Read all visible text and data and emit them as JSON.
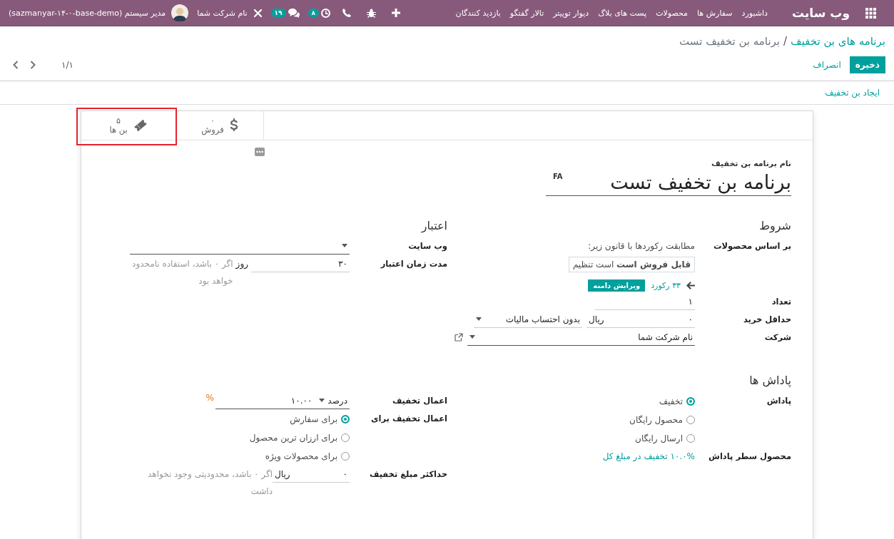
{
  "navbar": {
    "app_name": "وب سایت",
    "menu": [
      "داشبورد",
      "سفارش ها",
      "محصولات",
      "پست های بلاگ",
      "دیوار توییتر",
      "تالار گفتگو",
      "بازدید کنندگان"
    ],
    "activity_badge": "۸",
    "messages_badge": "۱۹",
    "company": "نام شرکت شما",
    "user": "مدیر سیستم (sazmanyar-۱۴-۰-base-demo)"
  },
  "breadcrumb": {
    "parent": "برنامه های بن تخفیف",
    "separator": "/",
    "current": "برنامه بن تخفیف تست"
  },
  "buttons": [
    {
      "label": "ذخیره",
      "kind": "primary"
    },
    {
      "label": "انصراف",
      "kind": "link"
    }
  ],
  "pager": "۱/۱",
  "toolbar_links": [
    "ایجاد بن تخفیف"
  ],
  "stat_buttons": [
    {
      "kind": "sales",
      "count": "۰",
      "label": "فروش",
      "highlighted": false
    },
    {
      "kind": "coupons",
      "count": "۵",
      "label": "بن ها",
      "highlighted": true
    }
  ],
  "form": {
    "name_label": "نام برنامه بن تخفیف",
    "name": "برنامه بن تخفیف تست",
    "language": "FA",
    "conditions": {
      "title": "شروط",
      "rows": [
        {
          "kind": "domain",
          "label": "بر اساس محصولات",
          "intro": "مطابقت رکوردها با قانون زیر:",
          "rule": "**قابل فروش است** است تنظیم",
          "records": "۳۳ رکورد",
          "button": "ویرایش دامنه"
        },
        {
          "kind": "input",
          "label": "تعداد",
          "value": "۱"
        },
        {
          "kind": "amount",
          "label": "حداقل خرید",
          "value": "۰",
          "currency": "ریال",
          "select": "بدون احتساب مالیات"
        },
        {
          "kind": "select",
          "label": "شرکت",
          "value": "نام شرکت شما",
          "external_link": true
        }
      ]
    },
    "validity": {
      "title": "اعتبار",
      "rows": [
        {
          "kind": "select",
          "label": "وب سایت"
        },
        {
          "kind": "duration",
          "label": "مدت زمان اعتبار",
          "value": "۳۰",
          "unit": "روز",
          "hint": "اگر ۰ باشد، استفاده نامحدود خواهد بود"
        }
      ]
    },
    "rewards": {
      "title": "پاداش ها",
      "rows": [
        {
          "kind": "radio",
          "label": "پاداش",
          "options": [
            {
              "label": "تخفیف",
              "selected": true
            },
            {
              "label": "محصول رایگان",
              "selected": false
            },
            {
              "label": "ارسال رایگان",
              "selected": false
            }
          ]
        },
        {
          "kind": "text",
          "label": "محصول سطر پاداش",
          "value": "۱۰.۰% تخفیف در مبلغ کل"
        }
      ]
    },
    "discount": {
      "rows": [
        {
          "kind": "discount",
          "label": "اعمال تخفیف",
          "type": "درصد",
          "value": "۱۰.۰۰",
          "unit": "%"
        },
        {
          "kind": "radio",
          "label": "اعمال تخفیف برای",
          "options": [
            {
              "label": "برای سفارش",
              "selected": true
            },
            {
              "label": "برای ارزان ترین محصول",
              "selected": false
            },
            {
              "label": "برای محصولات ویژه",
              "selected": false
            }
          ]
        },
        {
          "kind": "amount_hint",
          "label": "حداکثر مبلغ تخفیف",
          "value": "۰",
          "currency": "ریال",
          "hint": "اگر ۰ باشد، محدودیتی وجود نخواهد داشت"
        }
      ]
    }
  }
}
